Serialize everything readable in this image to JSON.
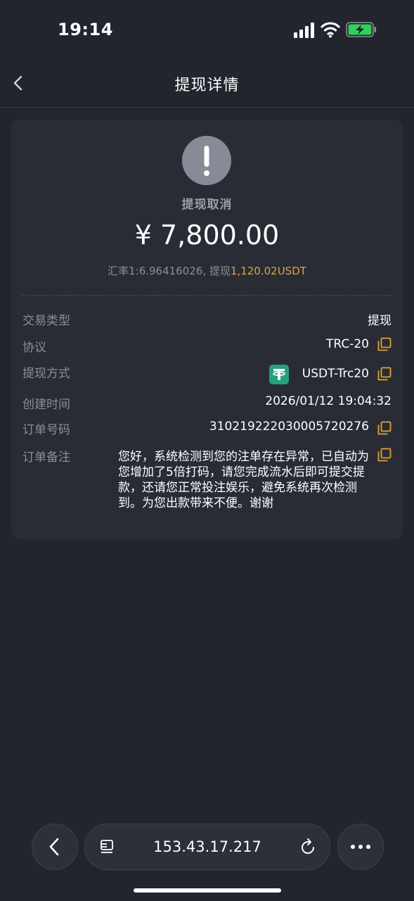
{
  "status_bar": {
    "time": "19:14"
  },
  "nav": {
    "title": "提现详情"
  },
  "summary": {
    "status": "提现取消",
    "amount": "¥ 7,800.00",
    "rate_prefix": "汇率1:6.96416026, 提现",
    "rate_usdt": "1,120.02USDT"
  },
  "details": {
    "type_label": "交易类型",
    "type_value": "提现",
    "protocol_label": "协议",
    "protocol_value": "TRC-20",
    "method_label": "提现方式",
    "method_value": "USDT-Trc20",
    "time_label": "创建时间",
    "time_value": "2026/01/12 19:04:32",
    "order_label": "订单号码",
    "order_value": "310219222030005720276",
    "note_label": "订单备注",
    "note_value": "您好，系统检测到您的注单存在异常，已自动为您增加了5倍打码，请您完成流水后即可提交提款，还请您正常投注娱乐，避免系统再次检测到。为您出款带来不便。谢谢"
  },
  "browser": {
    "url": "153.43.17.217"
  },
  "colors": {
    "background": "#22252e",
    "card": "#292c35",
    "accent_orange": "#e0a33a",
    "tether_green": "#26a17b",
    "battery_green": "#30d158"
  },
  "icons": [
    "signal-icon",
    "wifi-icon",
    "battery-icon",
    "chevron-left-icon",
    "alert-icon",
    "copy-icon",
    "tether-icon",
    "tabs-icon",
    "reload-icon",
    "more-icon"
  ]
}
